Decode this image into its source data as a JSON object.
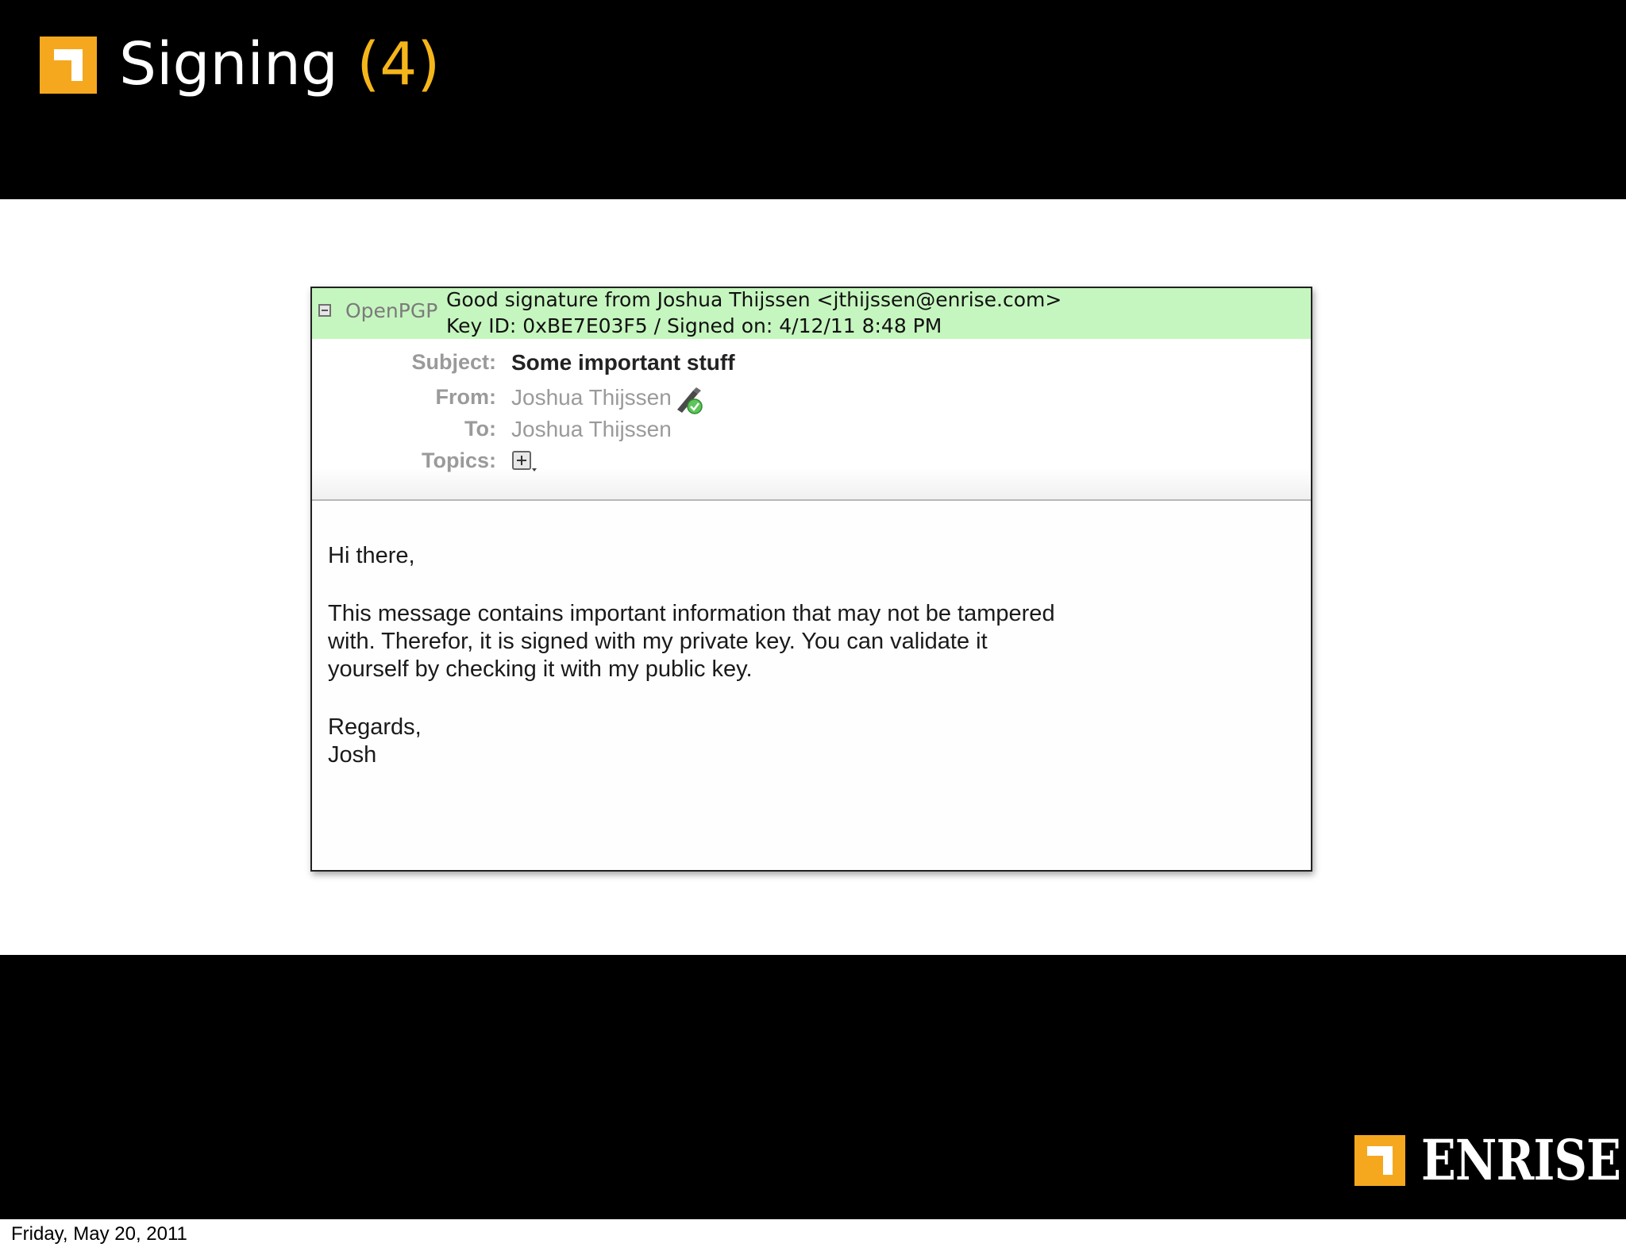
{
  "slide": {
    "title_text": "Signing",
    "title_number": "(4)"
  },
  "email": {
    "openpgp": {
      "label": "OpenPGP",
      "line1": "Good signature from Joshua Thijssen <jthijssen@enrise.com>",
      "line2": "Key ID: 0xBE7E03F5 / Signed on: 4/12/11 8:48 PM",
      "bar_color": "#c6f6bf"
    },
    "headers": {
      "subject_label": "Subject:",
      "subject_value": "Some important stuff",
      "from_label": "From:",
      "from_value": "Joshua Thijssen",
      "to_label": "To:",
      "to_value": "Joshua Thijssen",
      "topics_label": "Topics:"
    },
    "body": {
      "greeting": "Hi there,",
      "line1": "This message contains important information that may not be tampered",
      "line2": "with. Therefor, it is signed with my private key. You can validate it",
      "line3": "yourself by checking it with my public key.",
      "closing": "Regards,",
      "signature": "Josh"
    },
    "icons": [
      "collapse-icon",
      "signed-pen-check-icon",
      "add-topic-icon"
    ]
  },
  "brand": {
    "name": "ENRISE",
    "accent_color": "#f5a81e"
  },
  "footer": {
    "date": "Friday, May 20, 2011"
  }
}
